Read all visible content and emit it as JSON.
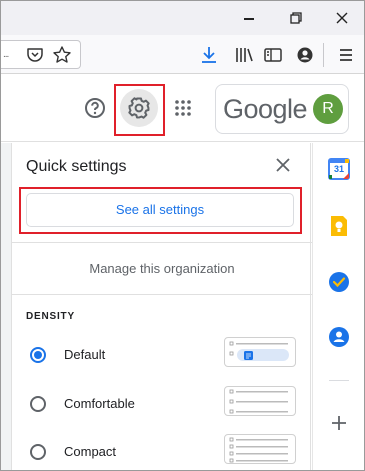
{
  "window": {
    "controls": [
      "minimize",
      "restore",
      "close"
    ]
  },
  "browser_toolbar": {
    "url_fragment": "...",
    "icons": [
      "pocket-icon",
      "star-icon",
      "download-icon",
      "library-icon",
      "reader-icon",
      "account-icon",
      "menu-icon"
    ],
    "download_color": "#1a73e8"
  },
  "gmail_header": {
    "google_logo_text": "Google",
    "avatar_initial": "R",
    "avatar_color": "#5f9e3f",
    "highlight_color": "#e0202a"
  },
  "quick_settings": {
    "title": "Quick settings",
    "see_all_label": "See all settings",
    "manage_label": "Manage this organization",
    "density_heading": "DENSITY",
    "density_options": [
      {
        "label": "Default",
        "selected": true
      },
      {
        "label": "Comfortable",
        "selected": false
      },
      {
        "label": "Compact",
        "selected": false
      }
    ],
    "accent_color": "#1a73e8"
  },
  "side_panel": {
    "calendar_day": "31",
    "apps": [
      "calendar-icon",
      "keep-icon",
      "tasks-icon",
      "contacts-icon"
    ]
  }
}
